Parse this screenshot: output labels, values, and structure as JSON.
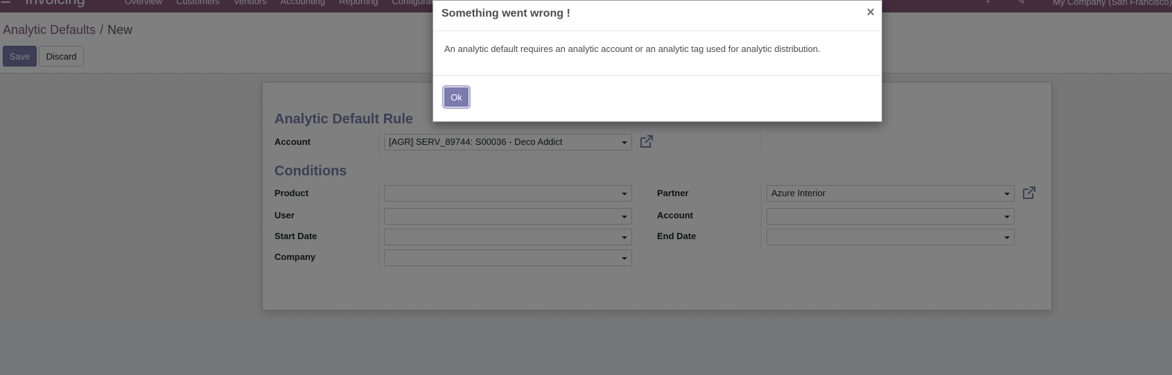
{
  "navbar": {
    "app_name": "Invoicing",
    "menu": [
      "Overview",
      "Customers",
      "Vendors",
      "Accounting",
      "Reporting",
      "Configuration"
    ],
    "company": "My Company (San Francisco)"
  },
  "breadcrumb": {
    "parent": "Analytic Defaults",
    "separator": "/",
    "current": "New"
  },
  "buttons": {
    "save": "Save",
    "discard": "Discard"
  },
  "form": {
    "rule_title": "Analytic Default Rule",
    "account_label": "Account",
    "account_value": "[AGR] SERV_89744: S00036 - Deco Addict",
    "conditions_title": "Conditions",
    "product_label": "Product",
    "product_value": "",
    "user_label": "User",
    "user_value": "",
    "start_date_label": "Start Date",
    "start_date_value": "",
    "company_label": "Company",
    "company_value": "",
    "partner_label": "Partner",
    "partner_value": "Azure Interior",
    "cond_account_label": "Account",
    "cond_account_value": "",
    "end_date_label": "End Date",
    "end_date_value": ""
  },
  "modal": {
    "title": "Something went wrong !",
    "close": "×",
    "message": "An analytic default requires an analytic account or an analytic tag used for analytic distribution.",
    "ok": "Ok"
  },
  "colors": {
    "brand": "#875a7b",
    "primary": "#7c7bad"
  }
}
